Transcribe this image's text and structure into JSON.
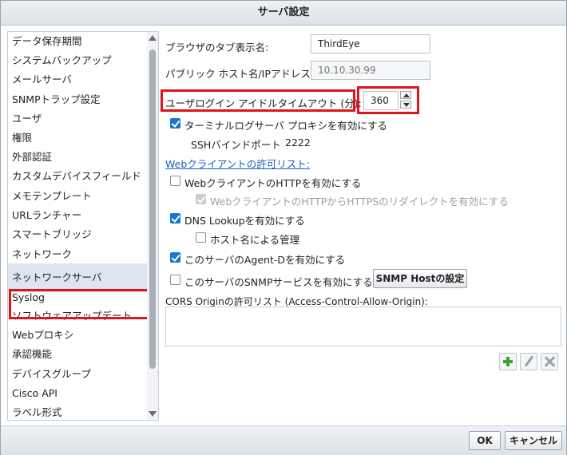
{
  "dialog": {
    "title": "サーバ設定"
  },
  "sidebar": {
    "items": [
      {
        "label": "データ保存期間"
      },
      {
        "label": "システムバックアップ"
      },
      {
        "label": "メールサーバ"
      },
      {
        "label": "SNMPトラップ設定"
      },
      {
        "label": "ユーザ"
      },
      {
        "label": "権限"
      },
      {
        "label": "外部認証"
      },
      {
        "label": "カスタムデバイスフィールド"
      },
      {
        "label": "メモテンプレート"
      },
      {
        "label": "URLランチャー"
      },
      {
        "label": "スマートブリッジ"
      },
      {
        "label": "ネットワーク"
      },
      {
        "label": "ネットワークサーバ"
      },
      {
        "label": "Syslog"
      },
      {
        "label": "ソフトウェアアップデート"
      },
      {
        "label": "Webプロキシ"
      },
      {
        "label": "承認機能"
      },
      {
        "label": "デバイスグループ"
      },
      {
        "label": "Cisco API"
      },
      {
        "label": "ラベル形式"
      }
    ],
    "selected_label": "ネットワークサーバ"
  },
  "form": {
    "browser_tab_label": "ブラウザのタブ表示名:",
    "browser_tab_value": "ThirdEye",
    "public_host_label": "パブリック ホスト名/IPアドレス:",
    "public_host_placeholder": "10.10.30.99",
    "idle_timeout_label": "ユーザログイン アイドルタイムアウト (分):",
    "idle_timeout_value": "360",
    "terminal_proxy_label": "ターミナルログサーバ プロキシを有効にする",
    "ssh_bind_port_label": "SSHバインドポート",
    "ssh_bind_port_value": "2222",
    "web_client_allow_link": "Webクライアントの許可リスト:",
    "web_http_label": "WebクライアントのHTTPを有効にする",
    "web_http_redirect_label": "WebクライアントのHTTPからHTTPSのリダイレクトを有効にする",
    "dns_lookup_label": "DNS Lookupを有効にする",
    "hostname_mgmt_label": "ホスト名による管理",
    "agent_d_label": "このサーバのAgent-Dを有効にする",
    "snmp_service_label": "このサーバのSNMPサービスを有効にする",
    "snmp_host_button": "SNMP Hostの設定",
    "cors_label": "CORS Originの許可リスト (Access-Control-Allow-Origin):"
  },
  "footer": {
    "ok_label": "OK",
    "cancel_label": "キャンセル"
  },
  "colors": {
    "highlight": "#e0141c",
    "checkbox": "#1976d2",
    "link": "#1a5fbf",
    "selected_row": "#dde5f1"
  }
}
